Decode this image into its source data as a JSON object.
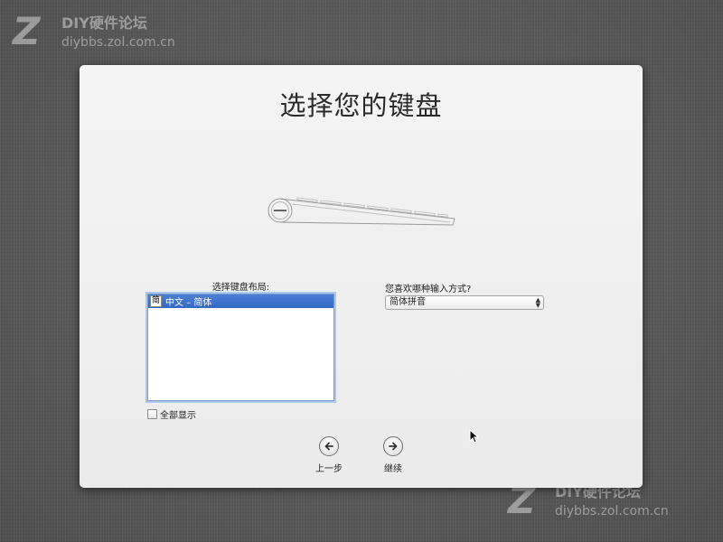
{
  "watermark": {
    "logo": "Z",
    "title": "DIY硬件论坛",
    "url": "diybbs.zol.com.cn",
    "footer_url": "diybbs.zol.com.cn"
  },
  "installer": {
    "title": "选择您的键盘",
    "layout_label": "选择键盘布局:",
    "layouts": [
      {
        "icon": "简",
        "label": "中文 – 简体",
        "selected": true
      }
    ],
    "input_method_label": "您喜欢哪种输入方式?",
    "input_method_value": "简体拼音",
    "show_all_label": "全部显示",
    "show_all_checked": false,
    "back_label": "上一步",
    "continue_label": "继续"
  },
  "colors": {
    "selection": "#3b6fc8",
    "background": "#5b5b5b",
    "panel": "#efefef"
  },
  "icons": {
    "back": "arrow-left-icon",
    "continue": "arrow-right-icon",
    "keyboard": "keyboard-icon",
    "cursor": "mouse-pointer-icon"
  }
}
